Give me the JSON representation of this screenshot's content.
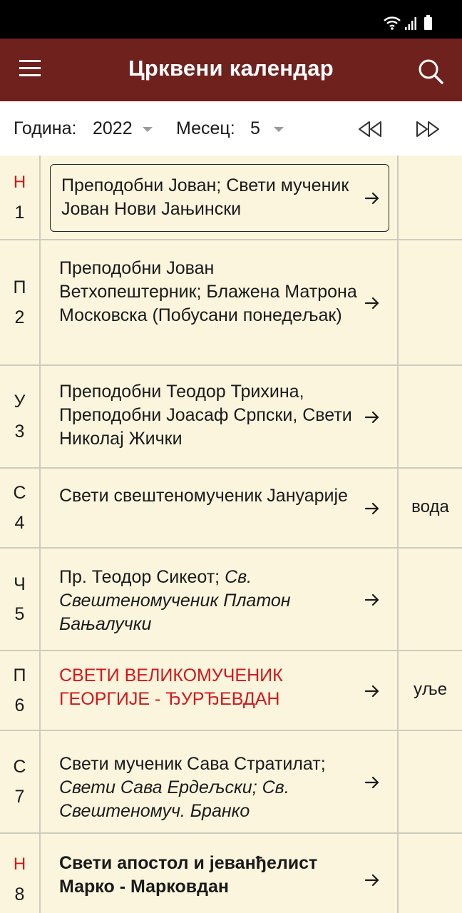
{
  "app": {
    "title": "Црквени календар"
  },
  "colors": {
    "app_bar": "#6e211d",
    "background": "#fbf5dd",
    "feast_red": "#d4171c"
  },
  "icons": {
    "menu": "hamburger-menu-icon",
    "search": "search-icon",
    "prev": "rewind-icon",
    "next": "fast-forward-icon",
    "row_arrow": "arrow-right-icon"
  },
  "filters": {
    "year_label": "Година:",
    "year_value": "2022",
    "month_label": "Месец:",
    "month_value": "5"
  },
  "days": [
    {
      "weekday": "Н",
      "day": "1",
      "sunday": true,
      "selected": true,
      "saints": [
        {
          "text": "Преподобни Јован; Свети мученик Јован Нови Јањински"
        }
      ],
      "fasting": ""
    },
    {
      "weekday": "П",
      "day": "2",
      "saints": [
        {
          "text": "Преподобни Јован Ветхопештерник; Блажена Матрона Московска (Побусани понедељак)"
        }
      ],
      "fasting": ""
    },
    {
      "weekday": "У",
      "day": "3",
      "saints": [
        {
          "text": "Преподобни Теодор Трихина, Преподобни Јоасаф Српски, Свети Николај Жички"
        }
      ],
      "fasting": ""
    },
    {
      "weekday": "С",
      "day": "4",
      "saints": [
        {
          "text": "Свети свештеномученик Јануарије"
        }
      ],
      "fasting": "вода"
    },
    {
      "weekday": "Ч",
      "day": "5",
      "saints": [
        {
          "text": "Пр. Теодор Сикеот; "
        },
        {
          "text": "Св. Свештеномученик Платон Бањалучки",
          "italic": true
        }
      ],
      "fasting": ""
    },
    {
      "weekday": "П",
      "day": "6",
      "feast": true,
      "saints": [
        {
          "text": "СВЕТИ ВЕЛИКОМУЧЕНИК ГЕОРГИЈЕ - ЂУРЂЕВДАН"
        }
      ],
      "fasting": "уље"
    },
    {
      "weekday": "С",
      "day": "7",
      "saints": [
        {
          "text": "Свети мученик Сава Стратилат; "
        },
        {
          "text": "Свети Сава Ердељски; Св. Свештеномуч. Бранко",
          "italic": true
        }
      ],
      "fasting": ""
    },
    {
      "weekday": "Н",
      "day": "8",
      "sunday": true,
      "bold": true,
      "saints": [
        {
          "text": "Свети апостол и јеванђелист Марко - Марковдан"
        }
      ],
      "fasting": ""
    }
  ]
}
